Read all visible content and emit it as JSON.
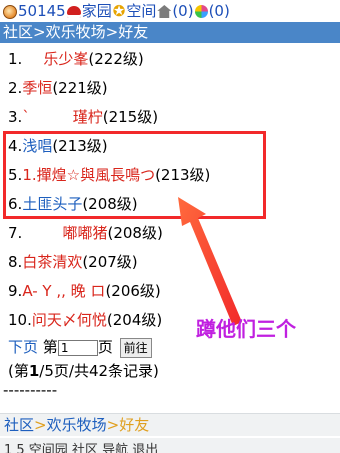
{
  "topbar": {
    "user_id": "50145",
    "links": [
      {
        "label": "家园",
        "icon": "hat-icon"
      },
      {
        "label": "空间",
        "icon": "star-icon"
      },
      {
        "label": "(0)",
        "icon": "house-icon"
      },
      {
        "label": "(0)",
        "icon": "flower-icon"
      }
    ]
  },
  "breadcrumb": {
    "community": "社区",
    "farm": "欢乐牧场",
    "current": "好友",
    "sep": ">"
  },
  "friends": [
    {
      "num": "1.",
      "name": "乐少峯",
      "level": "(222级)",
      "color": "red",
      "pad": "    "
    },
    {
      "num": "2.",
      "name": "季恒",
      "level": "(221级)",
      "color": "red",
      "pad": ""
    },
    {
      "num": "3.",
      "name": "ˋ         瑾柠",
      "level": "(215级)",
      "color": "red",
      "pad": ""
    },
    {
      "num": "4.",
      "name": "浅唱",
      "level": "(213级)",
      "color": "blue",
      "pad": ""
    },
    {
      "num": "5.",
      "name": "1.撣煌☆與風長鳴つ",
      "level": "(213级)",
      "color": "red",
      "pad": ""
    },
    {
      "num": "6.",
      "name": "土匪头子",
      "level": "(208级)",
      "color": "blue",
      "pad": ""
    },
    {
      "num": "7.",
      "name": "嘟嘟猪",
      "level": "(208级)",
      "color": "red",
      "pad": "        "
    },
    {
      "num": "8.",
      "name": "白茶清欢",
      "level": "(207级)",
      "color": "red",
      "pad": ""
    },
    {
      "num": "9.",
      "name": "A- Y ,, 晚 ロ",
      "level": "(206级)",
      "color": "red",
      "pad": ""
    },
    {
      "num": "10.",
      "name": "问天〆何悦",
      "level": "(204级)",
      "color": "red",
      "pad": ""
    }
  ],
  "pager": {
    "next": "下页",
    "page_prefix": "第",
    "page_value": "1",
    "page_suffix": "页",
    "go": "前往"
  },
  "summary": {
    "open": "(第",
    "current": "1",
    "rest": "/5页/共42条记录)"
  },
  "divider": "----------",
  "footer_breadcrumb": {
    "community": "社区",
    "farm": "欢乐牧场",
    "current": "好友",
    "sep": ">"
  },
  "footer_line": "1 5 空间园  社区  导航  退出",
  "annotation": {
    "text": "蹲他们三个",
    "box_color": "#f2292a",
    "text_color": "#c020e0"
  }
}
